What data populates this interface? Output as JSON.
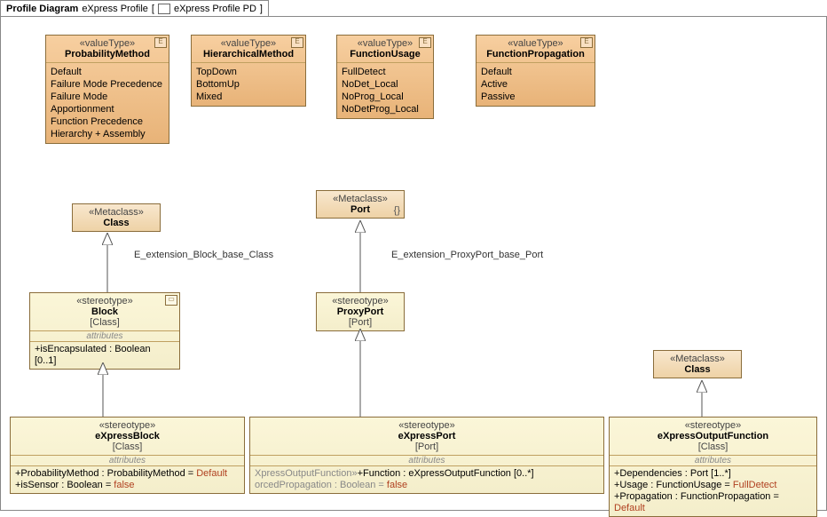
{
  "title_prefix": "Profile Diagram",
  "title_main": "eXpress Profile",
  "title_bracket": "eXpress Profile PD",
  "vt": {
    "probMethod": {
      "guillemet": "«valueType»",
      "name": "ProbabilityMethod",
      "items": [
        "Default",
        "Failure Mode Precedence",
        "Failure Mode Apportionment",
        "Function Precedence",
        "Hierarchy + Assembly"
      ]
    },
    "hierMethod": {
      "guillemet": "«valueType»",
      "name": "HierarchicalMethod",
      "items": [
        "TopDown",
        "BottomUp",
        "Mixed"
      ]
    },
    "funcUsage": {
      "guillemet": "«valueType»",
      "name": "FunctionUsage",
      "items": [
        "FullDetect",
        "NoDet_Local",
        "NoProg_Local",
        "NoDetProg_Local"
      ]
    },
    "funcProp": {
      "guillemet": "«valueType»",
      "name": "FunctionPropagation",
      "items": [
        "Default",
        "Active",
        "Passive"
      ]
    }
  },
  "mc": {
    "class1": {
      "guillemet": "«Metaclass»",
      "name": "Class"
    },
    "port": {
      "guillemet": "«Metaclass»",
      "name": "Port"
    },
    "class2": {
      "guillemet": "«Metaclass»",
      "name": "Class"
    }
  },
  "st": {
    "block": {
      "guillemet": "«stereotype»",
      "name": "Block",
      "sub": "[Class]",
      "attrLabel": "attributes",
      "attr1": "+isEncapsulated : Boolean [0..1]"
    },
    "proxy": {
      "guillemet": "«stereotype»",
      "name": "ProxyPort",
      "sub": "[Port]"
    },
    "exBlock": {
      "guillemet": "«stereotype»",
      "name": "eXpressBlock",
      "sub": "[Class]",
      "attrLabel": "attributes",
      "a1p": "+ProbabilityMethod : ProbabilityMethod = ",
      "a1v": "Default",
      "a2p": "+isSensor : Boolean = ",
      "a2v": "false"
    },
    "exPort": {
      "guillemet": "«stereotype»",
      "name": "eXpressPort",
      "sub": "[Port]",
      "attrLabel": "attributes",
      "a1pre": "XpressOutputFunction»",
      "a1p": "+Function : eXpressOutputFunction [0..*]",
      "a2pre": "orcedPropagation : Boolean = ",
      "a2v": "false"
    },
    "exOut": {
      "guillemet": "«stereotype»",
      "name": "eXpressOutputFunction",
      "sub": "[Class]",
      "attrLabel": "attributes",
      "a1": "+Dependencies : Port [1..*]",
      "a2p": "+Usage : FunctionUsage = ",
      "a2v": "FullDetect",
      "a3p": "+Propagation : FunctionPropagation = ",
      "a3v": "Default"
    }
  },
  "edge": {
    "blockClass": "E_extension_Block_base_Class",
    "proxyPort": "E_extension_ProxyPort_base_Port"
  }
}
